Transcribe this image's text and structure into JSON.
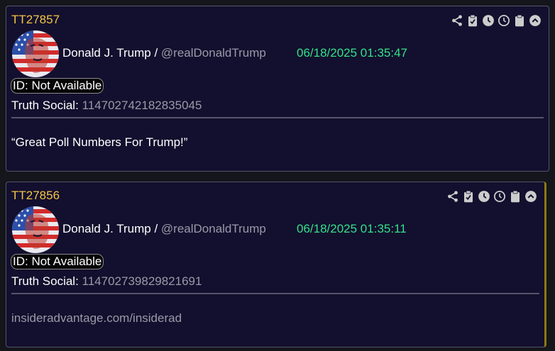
{
  "posts": [
    {
      "tt_id": "TT27857",
      "author_name": "Donald J. Trump /",
      "author_handle": "@realDonaldTrump",
      "timestamp": "06/18/2025 01:35:47",
      "id_label": "ID: Not Available",
      "ts_label": "Truth Social:",
      "ts_id": "114702742182835045",
      "content": "“Great Poll Numbers For Trump!”"
    },
    {
      "tt_id": "TT27856",
      "author_name": "Donald J. Trump /",
      "author_handle": "@realDonaldTrump",
      "timestamp": "06/18/2025 01:35:11",
      "id_label": "ID: Not Available",
      "ts_label": "Truth Social:",
      "ts_id": "114702739829821691",
      "content": "insideradvantage.com/insiderad"
    }
  ],
  "icons": [
    "share-icon",
    "clipboard-check-icon",
    "clock-solid-icon",
    "clock-outline-icon",
    "clipboard-icon",
    "chevron-up-circle-icon"
  ],
  "colors": {
    "card_bg": "#130f2e",
    "tt_id": "#f4c542",
    "timestamp": "#33e28a",
    "muted": "#9a9aa8"
  }
}
